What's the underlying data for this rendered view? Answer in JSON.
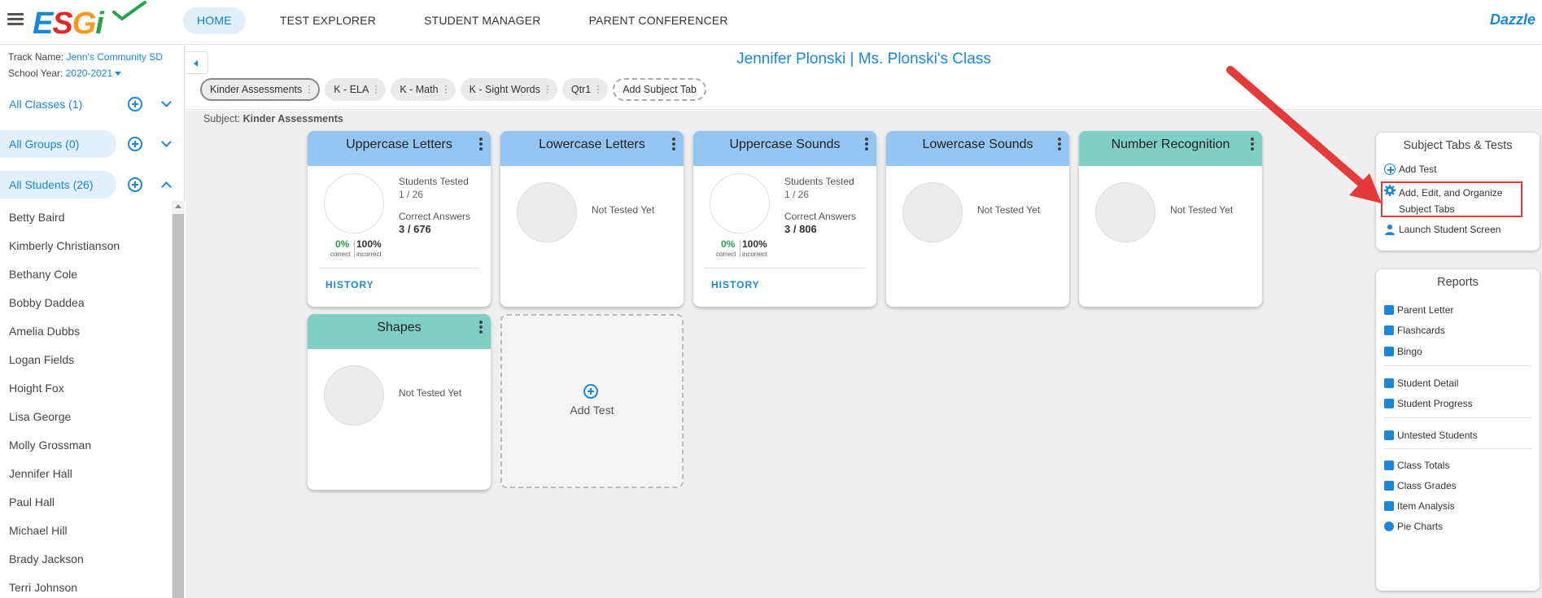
{
  "app": {
    "logo": {
      "e": "E",
      "s": "S",
      "g": "G",
      "i": "i"
    },
    "nav": [
      {
        "label": "HOME",
        "active": true
      },
      {
        "label": "TEST EXPLORER"
      },
      {
        "label": "STUDENT MANAGER"
      },
      {
        "label": "PARENT CONFERENCER"
      }
    ],
    "brand_right": "Dazzle"
  },
  "sidebar": {
    "track_label": "Track Name:",
    "track_value": "Jenn's Community SD",
    "year_label": "School Year:",
    "year_value": "2020-2021",
    "classes_label": "All Classes (1)",
    "groups_label": "All Groups (0)",
    "students_label": "All Students (26)",
    "students": [
      "Betty Baird",
      "Kimberly Christianson",
      "Bethany Cole",
      "Bobby Daddea",
      "Amelia Dubbs",
      "Logan Fields",
      "Hoight Fox",
      "Lisa George",
      "Molly Grossman",
      "Jennifer Hall",
      "Paul Hall",
      "Michael Hill",
      "Brady Jackson",
      "Terri Johnson"
    ]
  },
  "header": {
    "class_title": "Jennifer Plonski | Ms. Plonski's Class",
    "tabs": [
      "Kinder Assessments",
      "K - ELA",
      "K - Math",
      "K - Sight Words",
      "Qtr1"
    ],
    "add_tab_label": "Add Subject Tab"
  },
  "subject": {
    "label": "Subject:",
    "value": "Kinder Assessments"
  },
  "cards": [
    {
      "title": "Uppercase Letters",
      "tested_label": "Students Tested",
      "tested_value": "1 / 26",
      "correct_label": "Correct Answers",
      "correct_value": "3 / 676",
      "correct_pct": "0%",
      "incorrect_pct": "100%",
      "correct_lbl": "correct",
      "incorrect_lbl": "incorrect",
      "history": "HISTORY"
    },
    {
      "title": "Lowercase Letters",
      "not_tested": "Not Tested Yet"
    },
    {
      "title": "Uppercase Sounds",
      "tested_label": "Students Tested",
      "tested_value": "1 / 26",
      "correct_label": "Correct Answers",
      "correct_value": "3 / 806",
      "correct_pct": "0%",
      "incorrect_pct": "100%",
      "correct_lbl": "correct",
      "incorrect_lbl": "incorrect",
      "history": "HISTORY"
    },
    {
      "title": "Lowercase Sounds",
      "not_tested": "Not Tested Yet"
    },
    {
      "title": "Number Recognition",
      "not_tested": "Not Tested Yet"
    },
    {
      "title": "Shapes",
      "not_tested": "Not Tested Yet"
    }
  ],
  "add_test_card_label": "Add Test",
  "subject_panel": {
    "title": "Subject Tabs & Tests",
    "add_test": "Add Test",
    "organize_line1": "Add, Edit, and Organize",
    "organize_line2": "Subject Tabs",
    "launch": "Launch Student Screen"
  },
  "reports_panel": {
    "title": "Reports",
    "items": [
      "Parent Letter",
      "Flashcards",
      "Bingo",
      "Student Detail",
      "Student Progress",
      "Untested Students",
      "Class Totals",
      "Class Grades",
      "Item Analysis",
      "Pie Charts"
    ]
  },
  "colors": {
    "accent": "#1a88d6",
    "card_blue": "#93c6f2",
    "card_teal": "#7fcfc3",
    "highlight": "#e5393a",
    "correct_green": "#24a34a"
  }
}
